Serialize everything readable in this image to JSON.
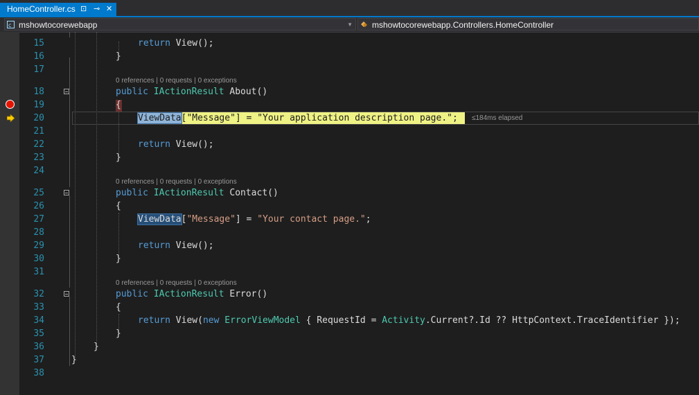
{
  "tab": {
    "title": "HomeController.cs",
    "pin_glyph": "⊡",
    "float_glyph": "⊸",
    "close_glyph": "✕"
  },
  "navigation": {
    "project": "mshowtocorewebapp",
    "class_path": "mshowtocorewebapp.Controllers.HomeController"
  },
  "line_numbers": [
    "15",
    "16",
    "17",
    "18",
    "19",
    "20",
    "21",
    "22",
    "23",
    "24",
    "25",
    "26",
    "27",
    "28",
    "29",
    "30",
    "31",
    "32",
    "33",
    "34",
    "35",
    "36",
    "37",
    "38"
  ],
  "codelens": "0 references | 0 requests | 0 exceptions",
  "perf_tip": "≤184ms elapsed",
  "code": {
    "l15_return": "return",
    "l15_rest": " View();",
    "close_brace": "}",
    "open_brace": "{",
    "public": "public",
    "iaction": "IActionResult",
    "about": " About()",
    "contact": " Contact()",
    "error": " Error()",
    "viewdata": "ViewData",
    "bracket_open": "[",
    "message_str": "\"Message\"",
    "assign": "] = ",
    "about_str": "\"Your application description page.\"",
    "semicolon": ";",
    "contact_str": "\"Your contact page.\"",
    "return_view_open": " View(",
    "new": "new",
    "error_model": "ErrorViewModel",
    "requestid": " { RequestId = ",
    "activity": "Activity",
    "rest34": ".Current?.Id ?? HttpContext.TraceIdentifier });",
    "view_close": " View();"
  },
  "breakpoint_line": "19",
  "current_line": "20",
  "colors": {
    "accent": "#007acc",
    "keyword": "#569cd6",
    "type": "#4ec9b0",
    "string": "#d69d85",
    "line_number": "#2b91af",
    "exec_highlight": "#eff284",
    "breakpoint": "#e51400"
  },
  "icons": [
    "csharp-project-icon",
    "class-icon",
    "breakpoint-icon",
    "execution-arrow-icon",
    "collapse-icon"
  ]
}
